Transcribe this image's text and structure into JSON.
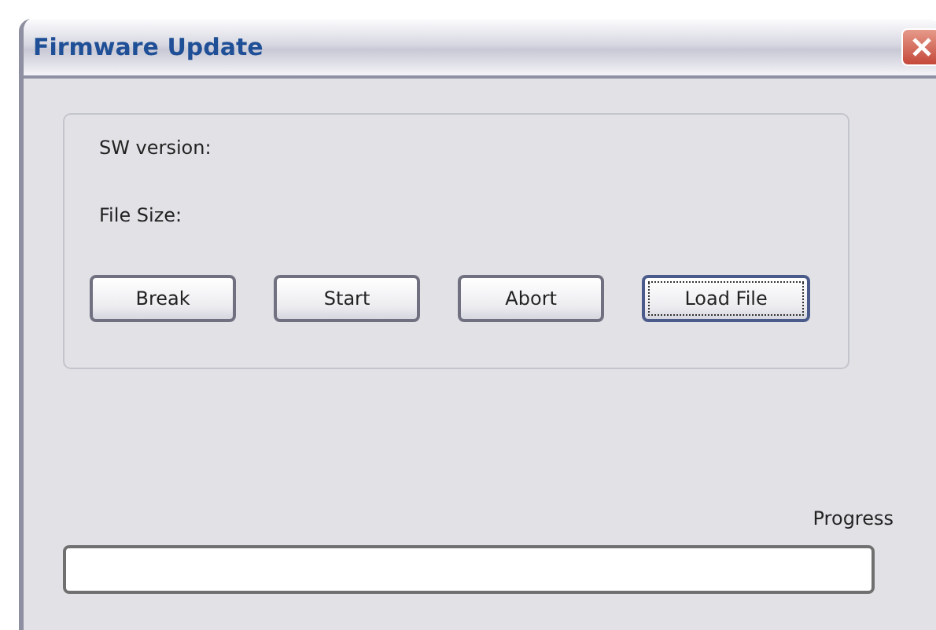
{
  "window": {
    "title": "Firmware Update"
  },
  "info": [
    {
      "label": "SW version:"
    },
    {
      "label": "File Size:"
    }
  ],
  "buttons": [
    {
      "label": "Break",
      "focused": false
    },
    {
      "label": "Start",
      "focused": false
    },
    {
      "label": "Abort",
      "focused": false
    },
    {
      "label": "Load File",
      "focused": true
    }
  ],
  "progress": {
    "label": "Progress",
    "level": 0
  }
}
